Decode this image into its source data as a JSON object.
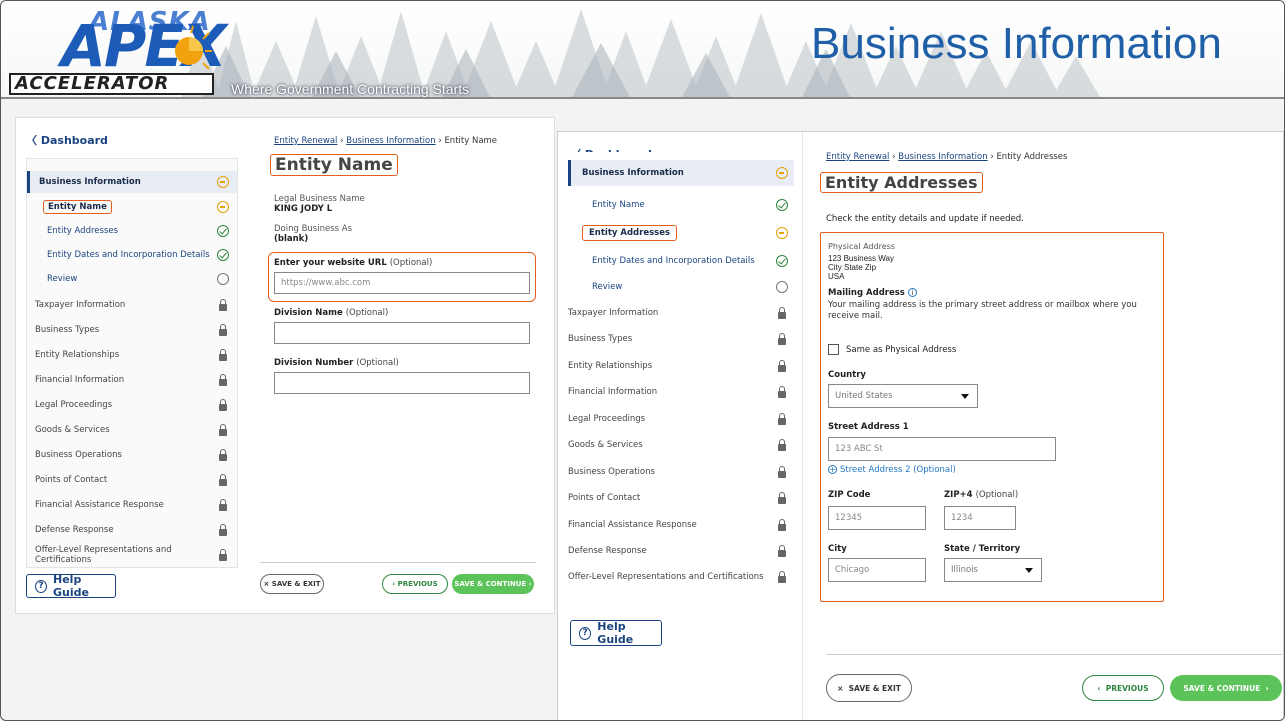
{
  "header": {
    "logo_top": "ALASKA",
    "logo_main": "APEX",
    "logo_bottom": "ACCELERATOR",
    "tagline": "Where Government Contracting Starts",
    "title": "Business Information"
  },
  "left": {
    "dashboard": "Dashboard",
    "sidebar": {
      "group": "Business Information",
      "subs": [
        "Entity Name",
        "Entity Addresses",
        "Entity Dates and Incorporation Details",
        "Review"
      ],
      "items": [
        "Taxpayer Information",
        "Business Types",
        "Entity Relationships",
        "Financial Information",
        "Legal Proceedings",
        "Goods & Services",
        "Business Operations",
        "Points of Contact",
        "Financial Assistance Response",
        "Defense Response",
        "Offer-Level Representations and Certifications"
      ]
    },
    "help": "Help Guide",
    "breadcrumb": {
      "a": "Entity Renewal",
      "b": "Business Information",
      "current": "Entity Name",
      "sep": "›"
    },
    "page_title": "Entity Name",
    "legal_label": "Legal Business Name",
    "legal_value": "KING JODY L",
    "dba_label": "Doing Business As",
    "dba_value": "(blank)",
    "url_label": "Enter your website URL",
    "url_opt": "(Optional)",
    "url_placeholder": "https://www.abc.com",
    "division_label": "Division Name",
    "division_opt": "(Optional)",
    "divnum_label": "Division Number",
    "divnum_opt": "(Optional)",
    "save_exit": "SAVE & EXIT",
    "previous": "PREVIOUS",
    "save_continue": "SAVE & CONTINUE"
  },
  "right": {
    "dashboard": "Dashboard",
    "sidebar": {
      "group": "Business Information",
      "subs": [
        "Entity Name",
        "Entity Addresses",
        "Entity Dates and Incorporation Details",
        "Review"
      ],
      "items": [
        "Taxpayer Information",
        "Business Types",
        "Entity Relationships",
        "Financial Information",
        "Legal Proceedings",
        "Goods & Services",
        "Business Operations",
        "Points of Contact",
        "Financial Assistance Response",
        "Defense Response",
        "Offer-Level Representations and Certifications"
      ]
    },
    "help": "Help Guide",
    "breadcrumb": {
      "a": "Entity Renewal",
      "b": "Business Information",
      "current": "Entity Addresses",
      "sep": "›"
    },
    "page_title": "Entity Addresses",
    "intro": "Check the entity details and update if needed.",
    "physical_label": "Physical Address",
    "physical_lines": [
      "123 Business Way",
      "City State Zip",
      "USA"
    ],
    "mailing_label": "Mailing Address",
    "mailing_desc": "Your mailing address is the primary street address or mailbox where you receive mail.",
    "same_as": "Same as Physical Address",
    "country_label": "Country",
    "country_value": "United States",
    "street_label": "Street Address 1",
    "street_value": "123 ABC St",
    "street2_link": "Street Address 2 (Optional)",
    "zip_label": "ZIP Code",
    "zip_value": "12345",
    "zip4_label": "ZIP+4",
    "zip4_opt": "(Optional)",
    "zip4_value": "1234",
    "city_label": "City",
    "city_value": "Chicago",
    "state_label": "State / Territory",
    "state_value": "Illinois",
    "save_exit": "SAVE & EXIT",
    "previous": "PREVIOUS",
    "save_continue": "SAVE & CONTINUE"
  }
}
